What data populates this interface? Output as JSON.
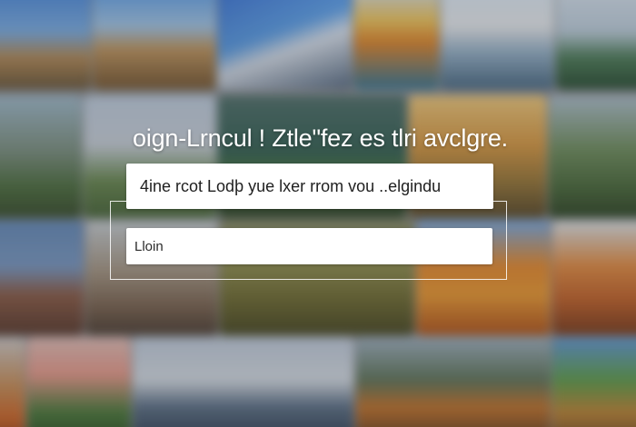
{
  "login_screen": {
    "headline": "oign-Lrncul ! Ztle\"fez es tlri avclgre.",
    "prompt_text": "4ine rcot Lodþ yue lxer  rrom  vou  ..elgindu",
    "login_field": {
      "value": "",
      "placeholder": "Lloin"
    }
  }
}
